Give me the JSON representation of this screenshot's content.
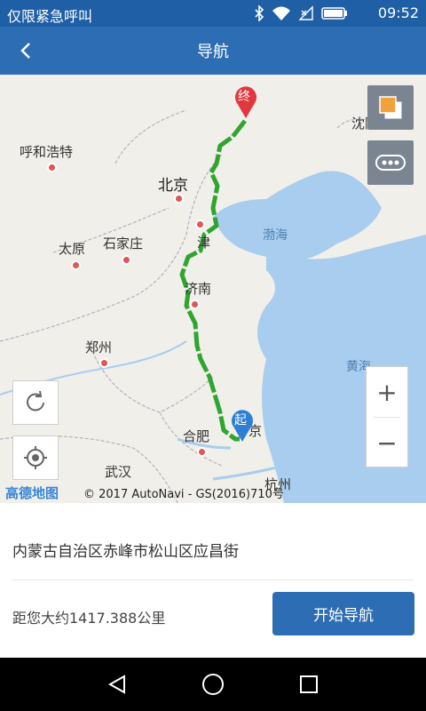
{
  "status_bar": {
    "carrier": "仅限紧急呼叫",
    "time": "09:52",
    "icons": [
      "bluetooth-icon",
      "wifi-icon",
      "signal-off-icon",
      "battery-icon"
    ]
  },
  "app_bar": {
    "title": "导航",
    "back_icon": "back-arrow-icon"
  },
  "map": {
    "cities": {
      "hohhot": "呼和浩特",
      "beijing": "北京",
      "shenyang": "沈阳",
      "taiyuan": "太原",
      "shijiazhuang": "石家庄",
      "tianjin": "津",
      "jinan": "济南",
      "zhengzhou": "郑州",
      "hefei": "合肥",
      "wuhan": "武汉",
      "hangzhou": "杭州",
      "nanjing": "京"
    },
    "seas": {
      "bohai": "渤海",
      "yellow_sea": "黄海"
    },
    "markers": {
      "end": "终",
      "start": "起"
    },
    "zoom_in": "+",
    "zoom_out": "−",
    "attribution": "© 2017 AutoNavi - GS(2016)710号",
    "logo": "高德地图",
    "route_color": "#2fa52f"
  },
  "destination": {
    "address": "内蒙古自治区赤峰市松山区应昌街",
    "distance": "距您大约1417.388公里",
    "start_button": "开始导航"
  },
  "colors": {
    "primary": "#2d6db3",
    "status_bar": "#1f5fa6"
  }
}
